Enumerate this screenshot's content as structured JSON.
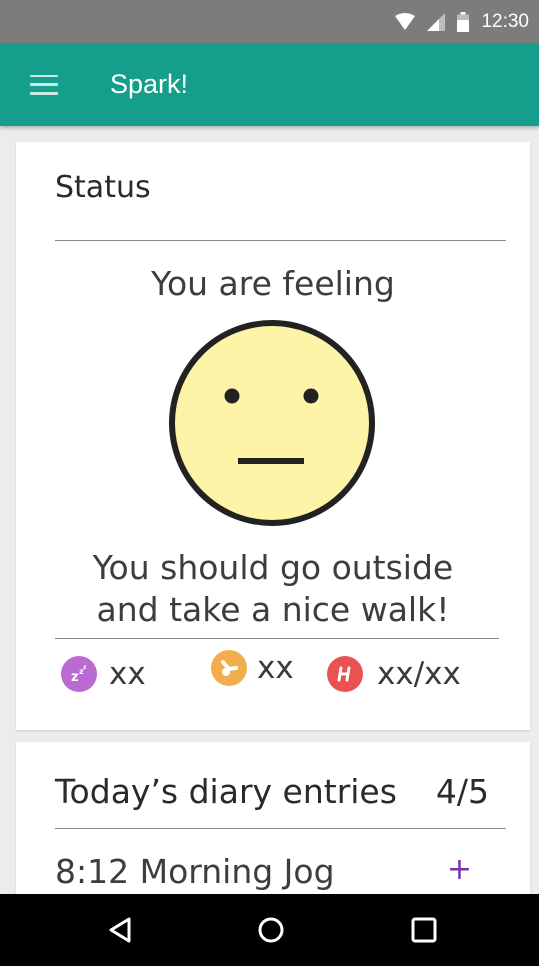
{
  "status_bar": {
    "time": "12:30",
    "icons": [
      "wifi-icon",
      "cellular-signal-icon",
      "battery-icon"
    ]
  },
  "app_bar": {
    "title": "Spark!",
    "menu_icon": "hamburger-menu-icon",
    "color": "#159e8b"
  },
  "status_card": {
    "title": "Status",
    "feeling_label": "You are feeling",
    "mood_icon": "neutral-face-icon",
    "face_color": "#fdf4a8",
    "advice_line1": "You should go outside",
    "advice_line2": "and take a nice walk!",
    "stats": [
      {
        "icon": "sleep-icon",
        "color": "#b96bd1",
        "value": "xx"
      },
      {
        "icon": "clock-icon",
        "color": "#f4ad4c",
        "value": "xx"
      },
      {
        "icon": "heart-rate-icon",
        "color": "#ea5152",
        "value": "xx/xx"
      }
    ]
  },
  "diary_card": {
    "title": "Today’s diary entries",
    "count": "4/5",
    "entries": [
      {
        "label": "8:12 Morning Jog",
        "action": "+"
      }
    ],
    "accent": "#7b2fae"
  },
  "nav_bar": {
    "buttons": [
      "back-icon",
      "home-icon",
      "recent-apps-icon"
    ]
  }
}
